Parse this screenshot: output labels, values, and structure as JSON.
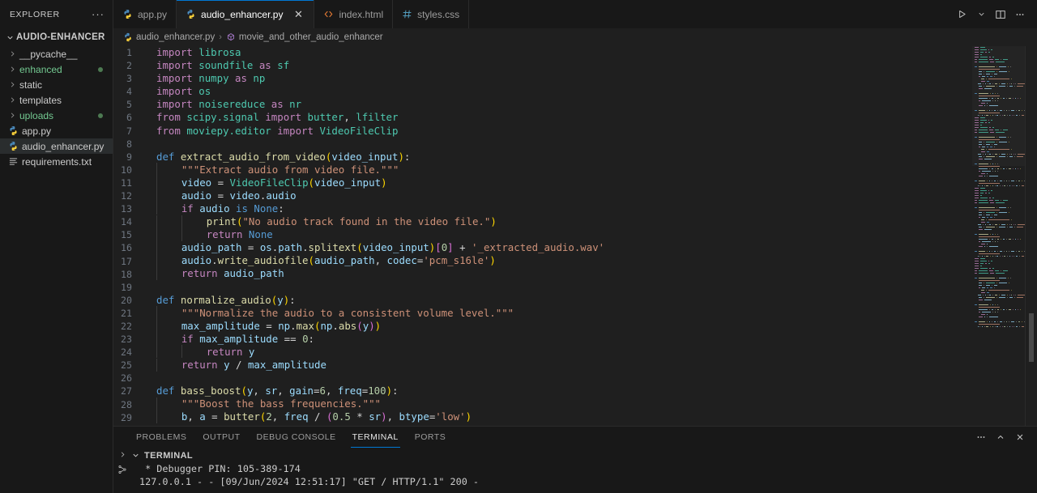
{
  "sidebar": {
    "header_title": "EXPLORER",
    "more_label": "···",
    "root_label": "AUDIO-ENHANCER",
    "items": [
      {
        "label": "__pycache__",
        "type": "folder",
        "git": false,
        "selected": false,
        "color": "normal"
      },
      {
        "label": "enhanced",
        "type": "folder",
        "git": true,
        "selected": false,
        "color": "green"
      },
      {
        "label": "static",
        "type": "folder",
        "git": false,
        "selected": false,
        "color": "normal"
      },
      {
        "label": "templates",
        "type": "folder",
        "git": false,
        "selected": false,
        "color": "normal"
      },
      {
        "label": "uploads",
        "type": "folder",
        "git": true,
        "selected": false,
        "color": "green"
      },
      {
        "label": "app.py",
        "type": "python",
        "git": false,
        "selected": false,
        "color": "normal"
      },
      {
        "label": "audio_enhancer.py",
        "type": "python",
        "git": false,
        "selected": true,
        "color": "normal"
      },
      {
        "label": "requirements.txt",
        "type": "text",
        "git": false,
        "selected": false,
        "color": "normal"
      }
    ]
  },
  "tabs": {
    "items": [
      {
        "label": "app.py",
        "icon": "python-icon",
        "active": false,
        "closable": false
      },
      {
        "label": "audio_enhancer.py",
        "icon": "python-icon",
        "active": true,
        "closable": true
      },
      {
        "label": "index.html",
        "icon": "html-icon",
        "active": false,
        "closable": false
      },
      {
        "label": "styles.css",
        "icon": "css-icon",
        "active": false,
        "closable": false
      }
    ],
    "close_glyph": "✕",
    "actions": [
      {
        "name": "run-python-file-button",
        "icon": "play-icon"
      },
      {
        "name": "run-options-button",
        "icon": "chevron-down-icon"
      },
      {
        "name": "split-editor-right-button",
        "icon": "split-editor-icon"
      },
      {
        "name": "more-editor-actions-button",
        "icon": "ellipsis-icon"
      }
    ]
  },
  "breadcrumbs": {
    "file": "audio_enhancer.py",
    "separator": "›",
    "symbol": "movie_and_other_audio_enhancer"
  },
  "editor": {
    "language": "python",
    "first_line": 1,
    "lines": [
      {
        "n": 1,
        "tokens": [
          [
            "kw",
            "import"
          ],
          [
            "op",
            " "
          ],
          [
            "mod",
            "librosa"
          ]
        ]
      },
      {
        "n": 2,
        "tokens": [
          [
            "kw",
            "import"
          ],
          [
            "op",
            " "
          ],
          [
            "mod",
            "soundfile"
          ],
          [
            "op",
            " "
          ],
          [
            "kw",
            "as"
          ],
          [
            "op",
            " "
          ],
          [
            "mod",
            "sf"
          ]
        ]
      },
      {
        "n": 3,
        "tokens": [
          [
            "kw",
            "import"
          ],
          [
            "op",
            " "
          ],
          [
            "mod",
            "numpy"
          ],
          [
            "op",
            " "
          ],
          [
            "kw",
            "as"
          ],
          [
            "op",
            " "
          ],
          [
            "mod",
            "np"
          ]
        ]
      },
      {
        "n": 4,
        "tokens": [
          [
            "kw",
            "import"
          ],
          [
            "op",
            " "
          ],
          [
            "mod",
            "os"
          ]
        ]
      },
      {
        "n": 5,
        "tokens": [
          [
            "kw",
            "import"
          ],
          [
            "op",
            " "
          ],
          [
            "mod",
            "noisereduce"
          ],
          [
            "op",
            " "
          ],
          [
            "kw",
            "as"
          ],
          [
            "op",
            " "
          ],
          [
            "mod",
            "nr"
          ]
        ]
      },
      {
        "n": 6,
        "tokens": [
          [
            "kw",
            "from"
          ],
          [
            "op",
            " "
          ],
          [
            "mod",
            "scipy.signal"
          ],
          [
            "op",
            " "
          ],
          [
            "kw",
            "import"
          ],
          [
            "op",
            " "
          ],
          [
            "mod",
            "butter"
          ],
          [
            "op",
            ", "
          ],
          [
            "mod",
            "lfilter"
          ]
        ]
      },
      {
        "n": 7,
        "tokens": [
          [
            "kw",
            "from"
          ],
          [
            "op",
            " "
          ],
          [
            "mod",
            "moviepy.editor"
          ],
          [
            "op",
            " "
          ],
          [
            "kw",
            "import"
          ],
          [
            "op",
            " "
          ],
          [
            "cls",
            "VideoFileClip"
          ]
        ]
      },
      {
        "n": 8,
        "tokens": []
      },
      {
        "n": 9,
        "tokens": [
          [
            "kw2",
            "def"
          ],
          [
            "op",
            " "
          ],
          [
            "fn",
            "extract_audio_from_video"
          ],
          [
            "pl",
            "("
          ],
          [
            "var",
            "video_input"
          ],
          [
            "pl",
            ")"
          ],
          [
            "op",
            ":"
          ]
        ]
      },
      {
        "n": 10,
        "indent": 1,
        "tokens": [
          [
            "doc",
            "\"\"\"Extract audio from video file.\"\"\""
          ]
        ]
      },
      {
        "n": 11,
        "indent": 1,
        "tokens": [
          [
            "var",
            "video"
          ],
          [
            "op",
            " = "
          ],
          [
            "cls",
            "VideoFileClip"
          ],
          [
            "pl",
            "("
          ],
          [
            "var",
            "video_input"
          ],
          [
            "pl",
            ")"
          ]
        ]
      },
      {
        "n": 12,
        "indent": 1,
        "tokens": [
          [
            "var",
            "audio"
          ],
          [
            "op",
            " = "
          ],
          [
            "var",
            "video"
          ],
          [
            "op",
            "."
          ],
          [
            "var",
            "audio"
          ]
        ]
      },
      {
        "n": 13,
        "indent": 1,
        "tokens": [
          [
            "kw",
            "if"
          ],
          [
            "op",
            " "
          ],
          [
            "var",
            "audio"
          ],
          [
            "op",
            " "
          ],
          [
            "kw2",
            "is"
          ],
          [
            "op",
            " "
          ],
          [
            "kw2",
            "None"
          ],
          [
            "op",
            ":"
          ]
        ]
      },
      {
        "n": 14,
        "indent": 2,
        "tokens": [
          [
            "fn",
            "print"
          ],
          [
            "pl",
            "("
          ],
          [
            "str",
            "\"No audio track found in the video file.\""
          ],
          [
            "pl",
            ")"
          ]
        ]
      },
      {
        "n": 15,
        "indent": 2,
        "tokens": [
          [
            "kw",
            "return"
          ],
          [
            "op",
            " "
          ],
          [
            "kw2",
            "None"
          ]
        ]
      },
      {
        "n": 16,
        "indent": 1,
        "tokens": [
          [
            "var",
            "audio_path"
          ],
          [
            "op",
            " = "
          ],
          [
            "var",
            "os"
          ],
          [
            "op",
            "."
          ],
          [
            "var",
            "path"
          ],
          [
            "op",
            "."
          ],
          [
            "fn",
            "splitext"
          ],
          [
            "pl",
            "("
          ],
          [
            "var",
            "video_input"
          ],
          [
            "pl",
            ")"
          ],
          [
            "pl2",
            "["
          ],
          [
            "num",
            "0"
          ],
          [
            "pl2",
            "]"
          ],
          [
            "op",
            " + "
          ],
          [
            "str",
            "'_extracted_audio.wav'"
          ]
        ]
      },
      {
        "n": 17,
        "indent": 1,
        "tokens": [
          [
            "var",
            "audio"
          ],
          [
            "op",
            "."
          ],
          [
            "fn",
            "write_audiofile"
          ],
          [
            "pl",
            "("
          ],
          [
            "var",
            "audio_path"
          ],
          [
            "op",
            ", "
          ],
          [
            "var",
            "codec"
          ],
          [
            "op",
            "="
          ],
          [
            "str",
            "'pcm_s16le'"
          ],
          [
            "pl",
            ")"
          ]
        ]
      },
      {
        "n": 18,
        "indent": 1,
        "tokens": [
          [
            "kw",
            "return"
          ],
          [
            "op",
            " "
          ],
          [
            "var",
            "audio_path"
          ]
        ]
      },
      {
        "n": 19,
        "tokens": []
      },
      {
        "n": 20,
        "tokens": [
          [
            "kw2",
            "def"
          ],
          [
            "op",
            " "
          ],
          [
            "fn",
            "normalize_audio"
          ],
          [
            "pl",
            "("
          ],
          [
            "var",
            "y"
          ],
          [
            "pl",
            ")"
          ],
          [
            "op",
            ":"
          ]
        ]
      },
      {
        "n": 21,
        "indent": 1,
        "tokens": [
          [
            "doc",
            "\"\"\"Normalize the audio to a consistent volume level.\"\"\""
          ]
        ]
      },
      {
        "n": 22,
        "indent": 1,
        "tokens": [
          [
            "var",
            "max_amplitude"
          ],
          [
            "op",
            " = "
          ],
          [
            "var",
            "np"
          ],
          [
            "op",
            "."
          ],
          [
            "fn",
            "max"
          ],
          [
            "pl",
            "("
          ],
          [
            "var",
            "np"
          ],
          [
            "op",
            "."
          ],
          [
            "fn",
            "abs"
          ],
          [
            "pl2",
            "("
          ],
          [
            "var",
            "y"
          ],
          [
            "pl2",
            ")"
          ],
          [
            "pl",
            ")"
          ]
        ]
      },
      {
        "n": 23,
        "indent": 1,
        "tokens": [
          [
            "kw",
            "if"
          ],
          [
            "op",
            " "
          ],
          [
            "var",
            "max_amplitude"
          ],
          [
            "op",
            " == "
          ],
          [
            "num",
            "0"
          ],
          [
            "op",
            ":"
          ]
        ]
      },
      {
        "n": 24,
        "indent": 2,
        "tokens": [
          [
            "kw",
            "return"
          ],
          [
            "op",
            " "
          ],
          [
            "var",
            "y"
          ]
        ]
      },
      {
        "n": 25,
        "indent": 1,
        "tokens": [
          [
            "kw",
            "return"
          ],
          [
            "op",
            " "
          ],
          [
            "var",
            "y"
          ],
          [
            "op",
            " / "
          ],
          [
            "var",
            "max_amplitude"
          ]
        ]
      },
      {
        "n": 26,
        "tokens": []
      },
      {
        "n": 27,
        "tokens": [
          [
            "kw2",
            "def"
          ],
          [
            "op",
            " "
          ],
          [
            "fn",
            "bass_boost"
          ],
          [
            "pl",
            "("
          ],
          [
            "var",
            "y"
          ],
          [
            "op",
            ", "
          ],
          [
            "var",
            "sr"
          ],
          [
            "op",
            ", "
          ],
          [
            "var",
            "gain"
          ],
          [
            "op",
            "="
          ],
          [
            "num",
            "6"
          ],
          [
            "op",
            ", "
          ],
          [
            "var",
            "freq"
          ],
          [
            "op",
            "="
          ],
          [
            "num",
            "100"
          ],
          [
            "pl",
            ")"
          ],
          [
            "op",
            ":"
          ]
        ]
      },
      {
        "n": 28,
        "indent": 1,
        "tokens": [
          [
            "doc",
            "\"\"\"Boost the bass frequencies.\"\"\""
          ]
        ]
      },
      {
        "n": 29,
        "indent": 1,
        "tokens": [
          [
            "var",
            "b"
          ],
          [
            "op",
            ", "
          ],
          [
            "var",
            "a"
          ],
          [
            "op",
            " = "
          ],
          [
            "fn",
            "butter"
          ],
          [
            "pl",
            "("
          ],
          [
            "num",
            "2"
          ],
          [
            "op",
            ", "
          ],
          [
            "var",
            "freq"
          ],
          [
            "op",
            " / "
          ],
          [
            "pl2",
            "("
          ],
          [
            "num",
            "0.5"
          ],
          [
            "op",
            " * "
          ],
          [
            "var",
            "sr"
          ],
          [
            "pl2",
            ")"
          ],
          [
            "op",
            ", "
          ],
          [
            "var",
            "btype"
          ],
          [
            "op",
            "="
          ],
          [
            "str",
            "'low'"
          ],
          [
            "pl",
            ")"
          ]
        ]
      }
    ]
  },
  "panel": {
    "tabs": [
      {
        "label": "PROBLEMS",
        "active": false
      },
      {
        "label": "OUTPUT",
        "active": false
      },
      {
        "label": "DEBUG CONSOLE",
        "active": false
      },
      {
        "label": "TERMINAL",
        "active": true
      },
      {
        "label": "PORTS",
        "active": false
      }
    ],
    "actions": [
      {
        "name": "panel-more-actions-button",
        "icon": "ellipsis-icon"
      },
      {
        "name": "maximize-panel-button",
        "icon": "chevron-up-icon"
      },
      {
        "name": "close-panel-button",
        "icon": "close-icon"
      }
    ],
    "terminal_title": "TERMINAL",
    "gutter": [
      {
        "name": "terminal-prompt-icon",
        "icon": "chevron-right-icon"
      },
      {
        "name": "split-terminal-icon",
        "icon": "branch-icon"
      }
    ],
    "output_lines": [
      " * Debugger PIN: 105-389-174",
      "127.0.0.1 - - [09/Jun/2024 12:51:17] \"GET / HTTP/1.1\" 200 -"
    ]
  },
  "colors": {
    "accent": "#0078d4",
    "editor_bg": "#1f1f1f",
    "sidebar_bg": "#181818",
    "git_modified": "#73c991",
    "keyword": "#c586c0",
    "function": "#dcdcaa",
    "string": "#ce9178",
    "variable": "#9cdcfe",
    "number": "#b5cea8",
    "class": "#4ec9b0"
  }
}
